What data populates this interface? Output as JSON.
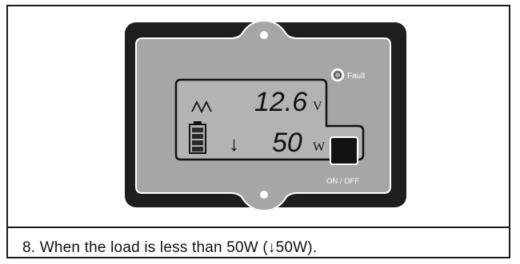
{
  "device": {
    "fault_label": "Fault",
    "power_button_label": "ON / OFF",
    "display": {
      "voltage_value": "12.6",
      "voltage_unit": "V",
      "power_prefix": "↓",
      "power_value": "50",
      "power_unit": "W",
      "wave_icon": "ac-wave-icon",
      "battery_icon": "battery-icon"
    }
  },
  "caption": "8. When the load is less than 50W (↓50W).",
  "colors": {
    "bezel": "#1e1e1e",
    "faceplate": "#a6a6a6",
    "lcd_background": "#b3b3b3",
    "outline": "#ffffff"
  }
}
